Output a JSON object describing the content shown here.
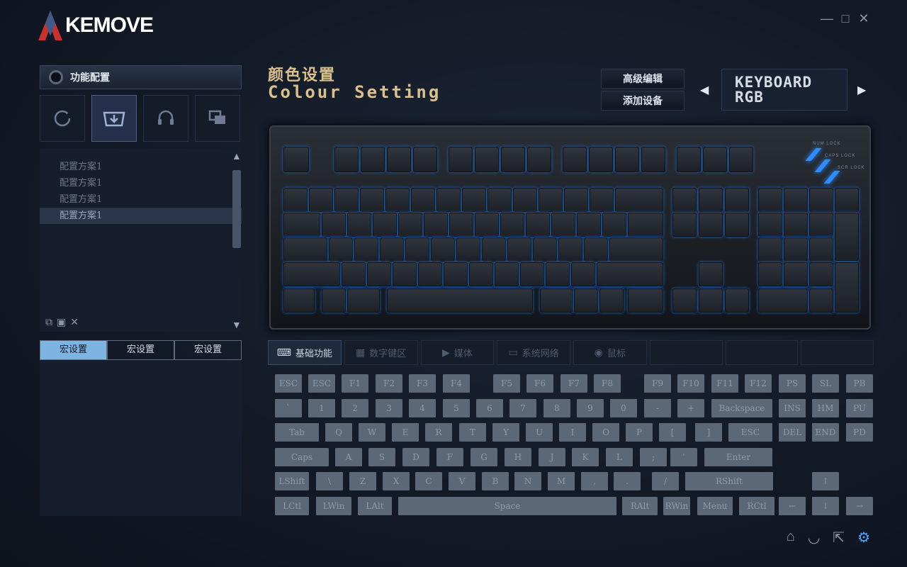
{
  "app": {
    "logo_text": "KEMOVE"
  },
  "window": {
    "minimize": "—",
    "maximize": "□",
    "close": "✕"
  },
  "sidebar": {
    "header": "功能配置",
    "profiles": [
      "配置方案1",
      "配置方案1",
      "配置方案1",
      "配置方案1"
    ],
    "selected_profile_index": 3,
    "macro_tabs": [
      "宏设置",
      "宏设置",
      "宏设置"
    ]
  },
  "main": {
    "title_cn": "颜色设置",
    "title_en": "Colour Setting",
    "advanced_edit": "高级编辑",
    "add_device": "添加设备",
    "device_line1": "KEYBOARD",
    "device_line2": "RGB"
  },
  "keyboard_labels": {
    "num_lock": "NUM LOCK",
    "caps_lock": "CAPS LOCK",
    "scr_lock": "SCR LOCK"
  },
  "tabs": [
    "基础功能",
    "数字键区",
    "媒体",
    "系统网络",
    "鼠标"
  ],
  "vkeys": {
    "row1": [
      "ESC",
      "ESC",
      "F1",
      "F2",
      "F3",
      "F4",
      "F5",
      "F6",
      "F7",
      "F8",
      "F9",
      "F10",
      "F11",
      "F12",
      "PS",
      "SL",
      "PB"
    ],
    "row2": [
      "`",
      "1",
      "2",
      "3",
      "4",
      "5",
      "6",
      "7",
      "8",
      "9",
      "0",
      "-",
      "+",
      "Backspace",
      "INS",
      "HM",
      "PU"
    ],
    "row3": [
      "Tab",
      "Q",
      "W",
      "E",
      "R",
      "T",
      "Y",
      "U",
      "I",
      "O",
      "P",
      "[",
      "]",
      "ESC",
      "DEL",
      "END",
      "PD"
    ],
    "row4": [
      "Caps",
      "A",
      "S",
      "D",
      "F",
      "G",
      "H",
      "J",
      "K",
      "L",
      ";",
      "'",
      "Enter"
    ],
    "row5": [
      "LShift",
      "\\",
      "Z",
      "X",
      "C",
      "V",
      "B",
      "N",
      "M",
      ",",
      ".",
      "/",
      "RShift",
      "↑"
    ],
    "row6": [
      "LCtl",
      "LWin",
      "LAlt",
      "Space",
      "RAlt",
      "RWin",
      "Menu",
      "RCtl",
      "←",
      "↓",
      "→"
    ]
  },
  "colors": {
    "accent": "#4aa3ff",
    "gold": "#d9c08c",
    "key_glow": "#1d6fd0"
  }
}
